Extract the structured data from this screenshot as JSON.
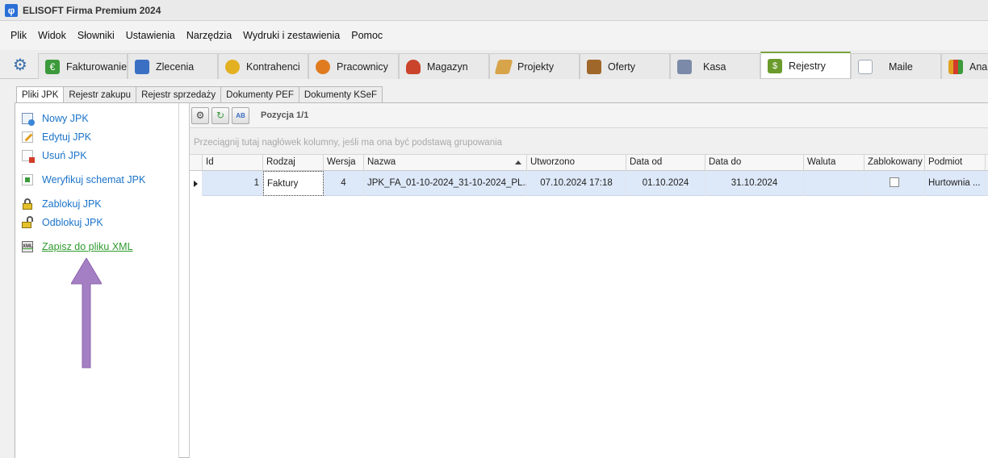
{
  "window": {
    "title": "ELISOFT Firma Premium 2024"
  },
  "menu": [
    "Plik",
    "Widok",
    "Słowniki",
    "Ustawienia",
    "Narzędzia",
    "Wydruki i zestawienia",
    "Pomoc"
  ],
  "modules": [
    {
      "label": "Fakturowanie",
      "icon": "invoice-euro-icon",
      "color": "#3c9a3c"
    },
    {
      "label": "Zlecenia",
      "icon": "orders-icon",
      "color": "#3a6fc4"
    },
    {
      "label": "Kontrahenci",
      "icon": "contractors-icon",
      "color": "#e3b021"
    },
    {
      "label": "Pracownicy",
      "icon": "employees-icon",
      "color": "#e07b1f"
    },
    {
      "label": "Magazyn",
      "icon": "warehouse-bag-icon",
      "color": "#c9442b"
    },
    {
      "label": "Projekty",
      "icon": "projects-ruler-icon",
      "color": "#d8a44a"
    },
    {
      "label": "Oferty",
      "icon": "offers-briefcase-icon",
      "color": "#a0672a"
    },
    {
      "label": "Kasa",
      "icon": "cash-register-icon",
      "color": "#7b8aa8"
    },
    {
      "label": "Rejestry",
      "icon": "registers-icon",
      "color": "#6b9b2c"
    },
    {
      "label": "Maile",
      "icon": "mail-envelope-icon",
      "color": "#9fa8b8"
    },
    {
      "label": "Ana",
      "icon": "analysis-chart-icon",
      "color": "#d23c2a"
    }
  ],
  "active_module": "Rejestry",
  "subtabs": [
    "Pliki JPK",
    "Rejestr zakupu",
    "Rejestr sprzedaży",
    "Dokumenty PEF",
    "Dokumenty KSeF"
  ],
  "active_subtab": "Pliki JPK",
  "actions": {
    "new": "Nowy JPK",
    "edit": "Edytuj JPK",
    "delete": "Usuń JPK",
    "verify": "Weryfikuj schemat JPK",
    "lock": "Zablokuj JPK",
    "unlock": "Odblokuj JPK",
    "save_xml": "Zapisz do pliku XML"
  },
  "grid": {
    "position_label": "Pozycja 1/1",
    "group_hint": "Przeciągnij tutaj nagłówek kolumny, jeśli ma ona być podstawą grupowania",
    "columns": [
      "Id",
      "Rodzaj",
      "Wersja",
      "Nazwa",
      "Utworzono",
      "Data od",
      "Data do",
      "Waluta",
      "Zablokowany",
      "Podmiot"
    ],
    "rows": [
      {
        "id": "1",
        "rodzaj": "Faktury",
        "wersja": "4",
        "nazwa": "JPK_FA_01-10-2024_31-10-2024_PL...",
        "utworzono": "07.10.2024 17:18",
        "data_od": "01.10.2024",
        "data_do": "31.10.2024",
        "waluta": "",
        "zablokowany": false,
        "podmiot": "Hurtownia ..."
      }
    ]
  },
  "annotation": {
    "arrow_color": "#a57fc4"
  }
}
